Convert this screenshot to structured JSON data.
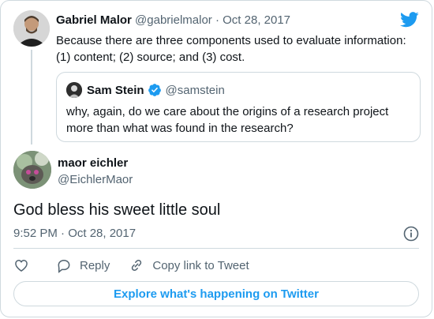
{
  "reply_tweet": {
    "author_name": "Gabriel Malor",
    "author_handle": "@gabrielmalor",
    "date": "· Oct 28, 2017",
    "text": "Because there are three components used to evaluate information: (1) content; (2) source; and (3) cost."
  },
  "quoted_tweet": {
    "author_name": "Sam Stein",
    "author_handle": "@samstein",
    "text": "why, again, do we care about the origins of a research project more than what was found in the research?"
  },
  "main_tweet": {
    "author_name": "maor eichler",
    "author_handle": "@EichlerMaor",
    "text": "God bless his sweet little soul",
    "timestamp": "9:52 PM · Oct 28, 2017"
  },
  "actions": {
    "reply_label": "Reply",
    "copy_link_label": "Copy link to Tweet"
  },
  "explore_label": "Explore what's happening on Twitter",
  "colors": {
    "accent": "#1d9bf0",
    "muted_text": "#536471",
    "border": "#cfd9de",
    "heart": "#536471"
  },
  "icons": [
    "twitter-bird-icon",
    "verified-badge-icon",
    "info-icon",
    "heart-icon",
    "reply-bubble-icon",
    "link-icon"
  ]
}
